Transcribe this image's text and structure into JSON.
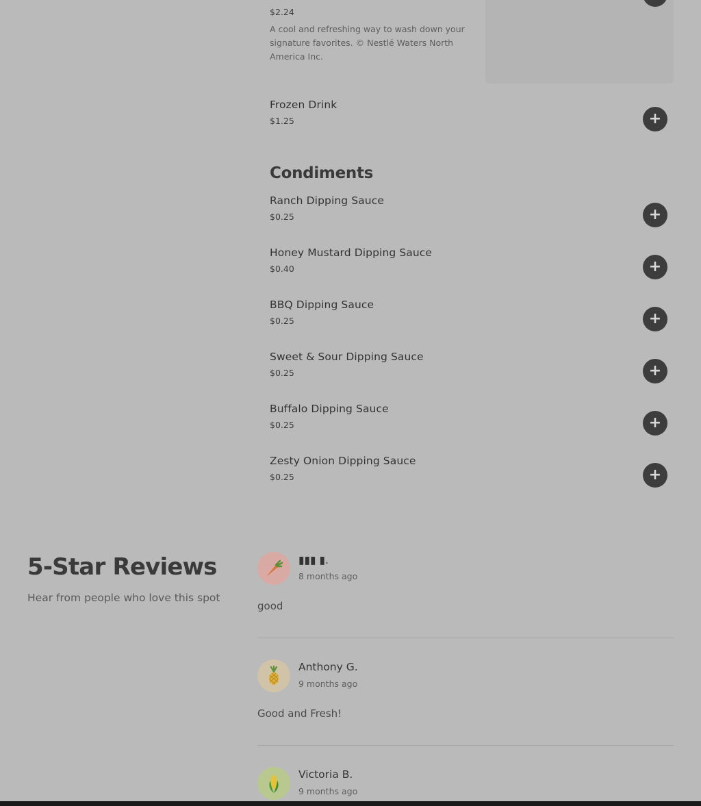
{
  "top_item": {
    "price": "$2.24",
    "description": "A cool and refreshing way to wash down your signature favorites. © Nestlé Waters North America Inc."
  },
  "drinks": [
    {
      "name": "Frozen Drink",
      "price": "$1.25"
    }
  ],
  "condiments": {
    "title": "Condiments",
    "items": [
      {
        "name": "Ranch Dipping Sauce",
        "price": "$0.25"
      },
      {
        "name": "Honey Mustard Dipping Sauce",
        "price": "$0.40"
      },
      {
        "name": "BBQ Dipping Sauce",
        "price": "$0.25"
      },
      {
        "name": "Sweet & Sour Dipping Sauce",
        "price": "$0.25"
      },
      {
        "name": "Buffalo Dipping Sauce",
        "price": "$0.25"
      },
      {
        "name": "Zesty Onion Dipping Sauce",
        "price": "$0.25"
      }
    ]
  },
  "add_button_symbol": "+",
  "reviews": {
    "title": "5-Star Reviews",
    "subtitle": "Hear from people who love this spot",
    "items": [
      {
        "name": "▮▮▮ ▮.",
        "time": "8 months ago",
        "text": "good",
        "avatar_icon": "carrot-icon",
        "avatar_bg": "#d9a9a3"
      },
      {
        "name": "Anthony G.",
        "time": "9 months ago",
        "text": "Good and Fresh!",
        "avatar_icon": "pineapple-icon",
        "avatar_bg": "#d1c3a8"
      },
      {
        "name": "Victoria B.",
        "time": "9 months ago",
        "text": "",
        "avatar_icon": "corn-icon",
        "avatar_bg": "#b9c88f"
      }
    ]
  }
}
